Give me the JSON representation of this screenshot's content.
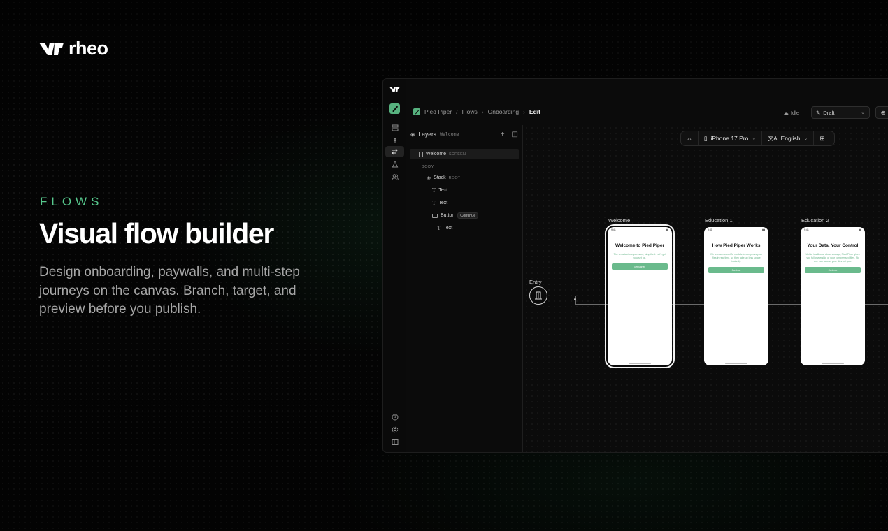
{
  "brand": {
    "name": "rheo"
  },
  "hero": {
    "eyebrow": "FLOWS",
    "headline": "Visual flow builder",
    "subcopy": "Design onboarding, paywalls, and multi-step journeys on the canvas. Branch, target, and preview before you publish."
  },
  "colors": {
    "accent": "#57c88d",
    "background": "#050505",
    "phone_button": "#6aba8c"
  },
  "app": {
    "rail_icons": [
      "logo-icon",
      "app-icon",
      "database-icon",
      "pin-icon",
      "flows-icon",
      "flask-icon",
      "users-icon",
      "help-icon",
      "gear-icon",
      "sidebar-toggle-icon"
    ],
    "breadcrumb": {
      "app": "Pied Piper",
      "section": "Flows",
      "flow": "Onboarding",
      "current": "Edit"
    },
    "status": "Idle",
    "version_select": "Draft",
    "layers": {
      "title": "Layers",
      "context": "Welcome",
      "tree": [
        {
          "label": "Welcome",
          "tag": "SCREEN"
        },
        {
          "section": "BODY"
        },
        {
          "label": "Stack",
          "tag": "ROOT"
        },
        {
          "label": "Text"
        },
        {
          "label": "Text"
        },
        {
          "label": "Button",
          "pill": "Continue"
        },
        {
          "label": "Text"
        }
      ]
    },
    "canvas_toolbar": {
      "device": "iPhone 17 Pro",
      "language": "English"
    },
    "entry_label": "Entry",
    "screens": [
      {
        "label": "Welcome",
        "title": "Welcome to Pied Piper",
        "body": "The smartest compression, simplified. Let's get you set up.",
        "button": "Get Started",
        "time": "9:41"
      },
      {
        "label": "Education 1",
        "title": "How Pied Piper Works",
        "body": "We use advanced AI models to compress your files in real time, so they take up less space instantly.",
        "button": "Continue",
        "time": "9:41"
      },
      {
        "label": "Education 2",
        "title": "Your Data, Your Control",
        "body": "Unlike traditional cloud storage, Pied Piper gives you full ownership of your compressed files. No one can access your files but you.",
        "button": "Continue",
        "time": "9:41"
      }
    ]
  }
}
